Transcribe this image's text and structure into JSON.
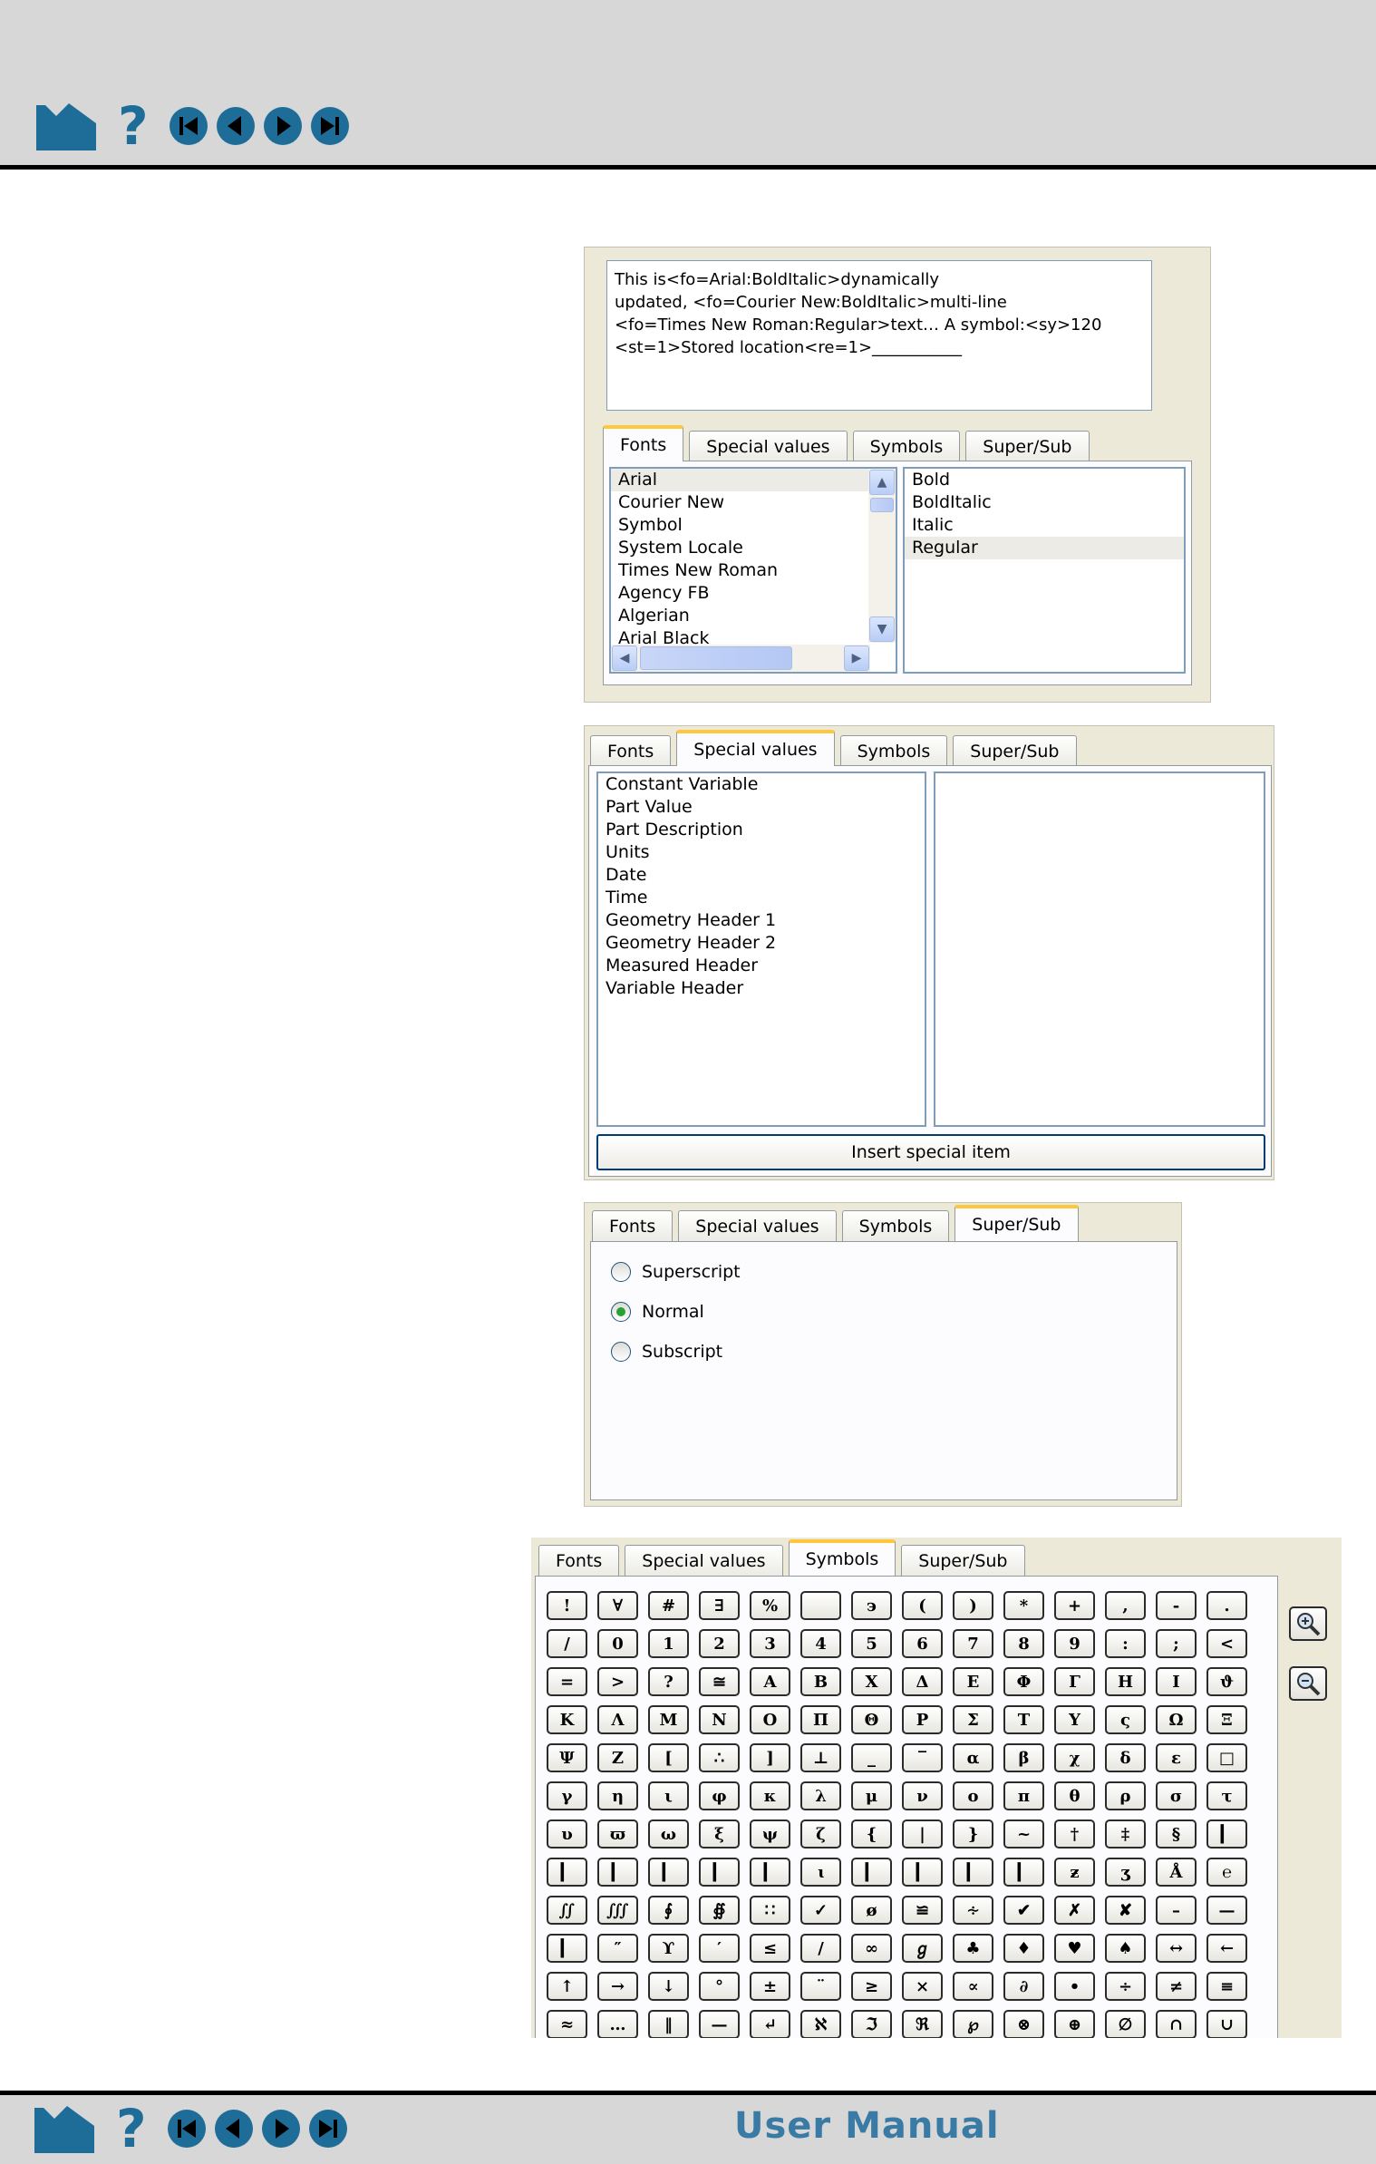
{
  "colors": {
    "nav_icon": "#1e6d99",
    "title": "#3a7ba5",
    "tab_highlight": "#ffc83c",
    "panel_bg": "#ece9d8",
    "list_border": "#7f9db9"
  },
  "nav": {
    "icons": [
      "home-icon",
      "help-icon",
      "first-page-icon",
      "previous-page-icon",
      "next-page-icon",
      "last-page-icon"
    ],
    "help_glyph": "?"
  },
  "footer": {
    "title": "User Manual"
  },
  "tabs": [
    "Fonts",
    "Special values",
    "Symbols",
    "Super/Sub"
  ],
  "fonts_panel": {
    "text_lines": [
      "This is<fo=Arial:BoldItalic>dynamically",
      "updated, <fo=Courier New:BoldItalic>multi-line",
      "<fo=Times New Roman:Regular>text… A symbol:<sy>120",
      "<st=1>Stored location<re=1>___________"
    ],
    "active_tab": "Fonts",
    "font_list": [
      "Arial",
      "Courier New",
      "Symbol",
      "System Locale",
      "Times New Roman",
      "Agency FB",
      "Algerian",
      "Arial Black"
    ],
    "selected_font": "Arial",
    "style_list": [
      "Bold",
      "BoldItalic",
      "Italic",
      "Regular"
    ],
    "selected_style": "Regular"
  },
  "special_panel": {
    "active_tab": "Special values",
    "items": [
      "Constant Variable",
      "Part Value",
      "Part Description",
      "Units",
      "Date",
      "Time",
      "Geometry Header 1",
      "Geometry Header 2",
      "Measured Header",
      "Variable Header"
    ],
    "insert_button": "Insert special item"
  },
  "supersub_panel": {
    "active_tab": "Super/Sub",
    "options": [
      "Superscript",
      "Normal",
      "Subscript"
    ],
    "selected": "Normal"
  },
  "symbols_panel": {
    "active_tab": "Symbols",
    "rows": [
      [
        "!",
        "∀",
        "#",
        "∃",
        "%",
        "",
        "϶",
        "(",
        ")",
        "*",
        "+",
        ",",
        "-",
        "."
      ],
      [
        "/",
        "0",
        "1",
        "2",
        "3",
        "4",
        "5",
        "6",
        "7",
        "8",
        "9",
        ":",
        ";",
        "<"
      ],
      [
        "=",
        ">",
        "?",
        "≅",
        "Α",
        "Β",
        "Χ",
        "Δ",
        "Ε",
        "Φ",
        "Γ",
        "Η",
        "Ι",
        "ϑ"
      ],
      [
        "Κ",
        "Λ",
        "Μ",
        "Ν",
        "Ο",
        "Π",
        "Θ",
        "Ρ",
        "Σ",
        "Τ",
        "Υ",
        "ς",
        "Ω",
        "Ξ"
      ],
      [
        "Ψ",
        "Ζ",
        "[",
        "∴",
        "]",
        "⊥",
        "_",
        "‾",
        "α",
        "β",
        "χ",
        "δ",
        "ε",
        "□"
      ],
      [
        "γ",
        "η",
        "ι",
        "φ",
        "κ",
        "λ",
        "μ",
        "ν",
        "ο",
        "π",
        "θ",
        "ρ",
        "σ",
        "τ"
      ],
      [
        "υ",
        "ϖ",
        "ω",
        "ξ",
        "ψ",
        "ζ",
        "{",
        "|",
        "}",
        "~",
        "†",
        "‡",
        "§",
        "▎"
      ],
      [
        "▎",
        "▎",
        "▎",
        "▎",
        "▎",
        "ɩ",
        "▎",
        "▎",
        "▎",
        "▎",
        "ƶ",
        "ʒ",
        "Å",
        "℮"
      ],
      [
        "∬",
        "∭",
        "∮",
        "∯",
        "∷",
        "✓",
        "ø",
        "≌",
        "∻",
        "✔",
        "✗",
        "✘",
        "–",
        "—"
      ],
      [
        "▎",
        "″",
        "ϒ",
        "′",
        "≤",
        "/",
        "∞",
        "ℊ",
        "♣",
        "♦",
        "♥",
        "♠",
        "↔",
        "←"
      ],
      [
        "↑",
        "→",
        "↓",
        "°",
        "±",
        "¨",
        "≥",
        "×",
        "∝",
        "∂",
        "•",
        "÷",
        "≠",
        "≡"
      ],
      [
        "≈",
        "…",
        "‖",
        "—",
        "↵",
        "ℵ",
        "ℑ",
        "ℜ",
        "℘",
        "⊗",
        "⊕",
        "∅",
        "∩",
        "∪"
      ]
    ]
  }
}
